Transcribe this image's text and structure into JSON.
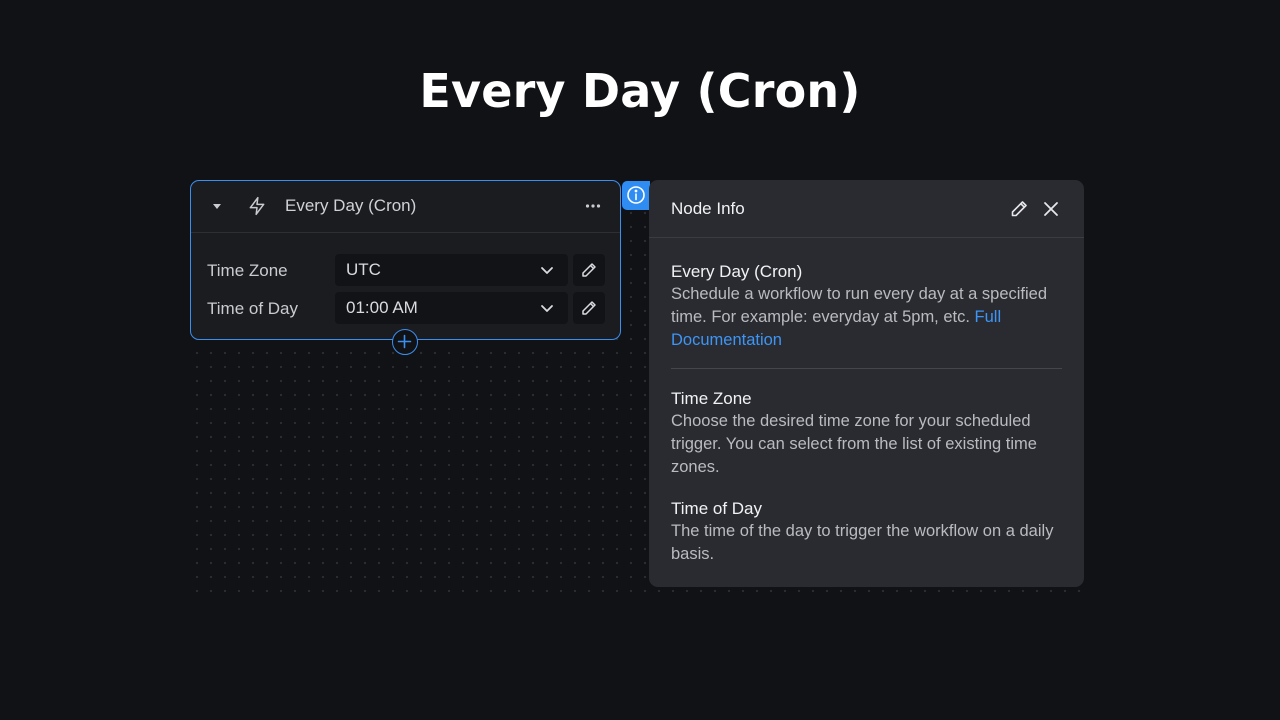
{
  "page": {
    "title": "Every Day (Cron)"
  },
  "node": {
    "title": "Every Day (Cron)",
    "icon": "lightning-bolt-icon",
    "fields": [
      {
        "label": "Time Zone",
        "value": "UTC"
      },
      {
        "label": "Time of Day",
        "value": "01:00 AM"
      }
    ]
  },
  "panel": {
    "title": "Node Info",
    "intro": {
      "title": "Every Day (Cron)",
      "text": "Schedule a workflow to run every day at a specified time. For example: everyday at 5pm, etc. ",
      "link": "Full Documentation"
    },
    "sections": [
      {
        "title": "Time Zone",
        "text": "Choose the desired time zone for your scheduled trigger. You can select from the list of existing time zones."
      },
      {
        "title": "Time of Day",
        "text": "The time of the day to trigger the workflow on a daily basis."
      }
    ]
  },
  "colors": {
    "accent": "#3b8ff0",
    "background": "#111216",
    "panel": "#2a2b30",
    "link": "#3d95f5"
  }
}
